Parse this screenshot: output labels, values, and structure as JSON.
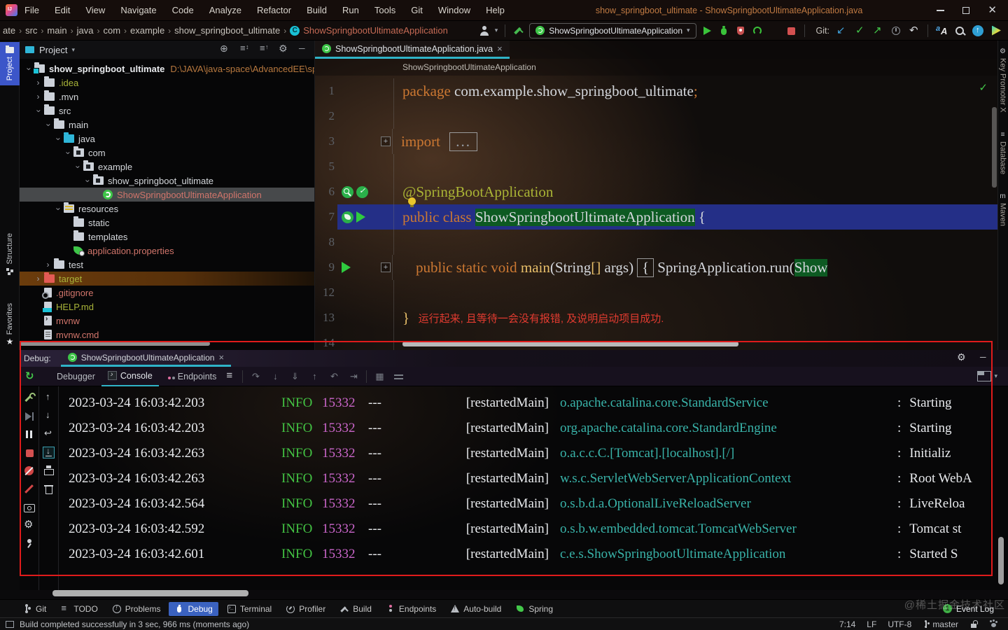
{
  "colors": {
    "accent_cyan": "#2fb3c7",
    "selected_blue": "#3b62c0",
    "stripe_blue": "#3c56c9",
    "info_green": "#43c343",
    "pid_magenta": "#cb66cb",
    "logger_teal": "#39b3a9",
    "keyword_orange": "#cc7832",
    "annotation_olive": "#aab435",
    "error_red": "#e23b30",
    "annotation_rect_red": "#e01b1b",
    "run_green": "#3ac33a",
    "stop_red": "#d35050"
  },
  "window": {
    "title": "show_springboot_ultimate - ShowSpringbootUltimateApplication.java",
    "menus": [
      "File",
      "Edit",
      "View",
      "Navigate",
      "Code",
      "Analyze",
      "Refactor",
      "Build",
      "Run",
      "Tools",
      "Git",
      "Window",
      "Help"
    ]
  },
  "navbar": {
    "crumbs": [
      "ate",
      "src",
      "main",
      "java",
      "com",
      "example",
      "show_springboot_ultimate"
    ],
    "sep": "›",
    "active_crumb": "ShowSpringbootUltimateApplication",
    "run_config": "ShowSpringbootUltimateApplication",
    "caret": "▾",
    "git_label": "Git:",
    "run_icons": [
      "run-play-icon",
      "debug-bug-icon",
      "coverage-icon",
      "profiler-icon",
      "caret-down-icon",
      "stop-icon"
    ],
    "git_icons": [
      "update-icon",
      "commit-check-icon",
      "push-icon",
      "history-icon",
      "rollback-icon"
    ],
    "right_icons": [
      "translate-icon",
      "search-icon",
      "upload-icon",
      "gradient-play-icon"
    ]
  },
  "left_stripe": {
    "top": [
      {
        "label": "Project",
        "icon": "project-folder-icon",
        "cls": "sel"
      }
    ],
    "bottom": [
      {
        "label": "Structure",
        "icon": "structure-icon",
        "cls": ""
      },
      {
        "label": "Favorites",
        "icon": "favorites-star-icon",
        "cls": ""
      }
    ]
  },
  "right_stripe": [
    {
      "label": "Key Promoter X",
      "glyph": "⚙"
    },
    {
      "label": "Database",
      "glyph": "≡"
    },
    {
      "label": "Maven",
      "glyph": "m"
    }
  ],
  "project": {
    "title": "Project",
    "caret": "▾",
    "header_icons": [
      "locate-icon",
      "expand-all-icon",
      "collapse-all-icon",
      "gear-icon",
      "hide-icon"
    ],
    "tree": [
      {
        "depth": 0,
        "chevron": "down",
        "icon": "t-folder t-project",
        "label": "show_springboot_ultimate",
        "extra": "D:\\JAVA\\java-space\\AdvancedEE\\sp",
        "c": "bold",
        "row": ""
      },
      {
        "depth": 1,
        "chevron": "right",
        "icon": "t-folder",
        "label": ".idea",
        "c": "olive",
        "row": ""
      },
      {
        "depth": 1,
        "chevron": "right",
        "icon": "t-folder",
        "label": ".mvn",
        "c": "",
        "row": ""
      },
      {
        "depth": 1,
        "chevron": "down",
        "icon": "t-folder",
        "label": "src",
        "c": "",
        "row": ""
      },
      {
        "depth": 2,
        "chevron": "down",
        "icon": "t-folder",
        "label": "main",
        "c": "",
        "row": ""
      },
      {
        "depth": 3,
        "chevron": "down",
        "icon": "t-folder t-java",
        "label": "java",
        "c": "",
        "row": ""
      },
      {
        "depth": 4,
        "chevron": "down",
        "icon": "t-folder t-pkg",
        "label": "com",
        "c": "",
        "row": ""
      },
      {
        "depth": 5,
        "chevron": "down",
        "icon": "t-folder t-pkg",
        "label": "example",
        "c": "",
        "row": ""
      },
      {
        "depth": 6,
        "chevron": "down",
        "icon": "t-folder t-pkg",
        "label": "show_springboot_ultimate",
        "c": "",
        "row": ""
      },
      {
        "depth": 7,
        "chevron": "",
        "icon": "t-sb",
        "label": "ShowSpringbootUltimateApplication",
        "c": "pink",
        "row": "selected"
      },
      {
        "depth": 3,
        "chevron": "down",
        "icon": "t-folder t-res",
        "label": "resources",
        "c": "",
        "row": ""
      },
      {
        "depth": 4,
        "chevron": "",
        "icon": "t-folder",
        "label": "static",
        "c": "",
        "row": ""
      },
      {
        "depth": 4,
        "chevron": "",
        "icon": "t-folder",
        "label": "templates",
        "c": "",
        "row": ""
      },
      {
        "depth": 4,
        "chevron": "",
        "icon": "t-leaf",
        "label": "application.properties",
        "c": "pink",
        "row": ""
      },
      {
        "depth": 2,
        "chevron": "right",
        "icon": "t-folder",
        "label": "test",
        "c": "",
        "row": ""
      },
      {
        "depth": 1,
        "chevron": "right",
        "icon": "t-folder t-red",
        "label": "target",
        "c": "olive",
        "row": "target-row"
      },
      {
        "depth": 1,
        "chevron": "",
        "icon": "t-doc t-ign",
        "label": ".gitignore",
        "c": "pink",
        "row": ""
      },
      {
        "depth": 1,
        "chevron": "",
        "icon": "t-doc t-md",
        "label": "HELP.md",
        "c": "olive",
        "row": ""
      },
      {
        "depth": 1,
        "chevron": "",
        "icon": "t-doc t-sh",
        "label": "mvnw",
        "c": "pink",
        "row": ""
      },
      {
        "depth": 1,
        "chevron": "",
        "icon": "t-doc t-cmd",
        "label": "mvnw.cmd",
        "c": "pink",
        "row": ""
      }
    ]
  },
  "editor": {
    "tab_label": "ShowSpringbootUltimateApplication.java",
    "tab_close": "×",
    "breadcrumb": "ShowSpringbootUltimateApplication",
    "inspections_ok": "✓",
    "lines": [
      {
        "num": "1",
        "fold": "",
        "cls": "",
        "gut": [],
        "tokens": [
          {
            "t": "package ",
            "c": "kw"
          },
          {
            "t": "com.example.show_springboot_ultimate",
            "c": "pl"
          },
          {
            "t": ";",
            "c": "kw"
          }
        ]
      },
      {
        "num": "2",
        "fold": "",
        "cls": "",
        "gut": [],
        "tokens": []
      },
      {
        "num": "3",
        "fold": "+",
        "cls": "",
        "gut": [],
        "tokens": [
          {
            "t": "import ",
            "c": "kw"
          },
          {
            "t": "...",
            "c": "foldbox"
          }
        ]
      },
      {
        "num": "5",
        "fold": "",
        "cls": "",
        "gut": [],
        "tokens": []
      },
      {
        "num": "6",
        "fold": "",
        "cls": "",
        "gut": [
          "gutter-spring-search-icon",
          "gutter-spring-check-icon"
        ],
        "tokens": [
          {
            "t": "@SpringBootApplication",
            "c": "ann"
          }
        ]
      },
      {
        "num": "7",
        "fold": "",
        "cls": "exec",
        "gut": [
          "gutter-spring-leaf-icon",
          "gutter-run-icon"
        ],
        "tokens": [
          {
            "t": "public class ",
            "c": "kw"
          },
          {
            "t": "ShowSpringbootUltimateApplication",
            "c": "pl hlg"
          },
          {
            "t": " {",
            "c": "pl"
          }
        ]
      },
      {
        "num": "8",
        "fold": "",
        "cls": "",
        "gut": [],
        "tokens": []
      },
      {
        "num": "9",
        "fold": "+",
        "cls": "",
        "gut": [
          "gutter-run-icon"
        ],
        "tokens": [
          {
            "t": "    public static void ",
            "c": "kw"
          },
          {
            "t": "main",
            "c": "fn"
          },
          {
            "t": "(String",
            "c": "pl"
          },
          {
            "t": "[]",
            "c": "fn"
          },
          {
            "t": " args)",
            "c": "pl"
          },
          {
            "t": "{",
            "c": "brbox"
          },
          {
            "t": "SpringApplication.run",
            "c": "pl"
          },
          {
            "t": "(",
            "c": "pl"
          },
          {
            "t": "Show",
            "c": "pl hlg"
          }
        ]
      },
      {
        "num": "12",
        "fold": "",
        "cls": "",
        "gut": [],
        "tokens": []
      },
      {
        "num": "13",
        "fold": "",
        "cls": "",
        "gut": [],
        "tokens": [
          {
            "t": "}",
            "c": "fn"
          },
          {
            "t": "   运行起来, 且等待一会没有报错, 及说明启动项目成功.",
            "c": "cmt"
          }
        ]
      },
      {
        "num": "14",
        "fold": "",
        "cls": "",
        "gut": [],
        "tokens": []
      }
    ]
  },
  "debug": {
    "label": "Debug:",
    "tab_label": "ShowSpringbootUltimateApplication",
    "tab_close": "×",
    "header_icons": [
      "gear-icon",
      "minimize-icon"
    ],
    "tabs": [
      {
        "label": "Debugger",
        "icon": "",
        "cls": ""
      },
      {
        "label": "Console",
        "icon": "console-icon",
        "cls": "sel"
      },
      {
        "label": "Endpoints",
        "icon": "endpoints-icon",
        "cls": ""
      }
    ],
    "step_icons": [
      "step-over-icon",
      "step-into-icon",
      "force-step-into-icon",
      "step-out-icon",
      "drop-frame-icon",
      "run-to-cursor-icon"
    ],
    "eval_icons": [
      "evaluate-icon",
      "layout-settings-icon"
    ],
    "left_icons": [
      "wrench-icon",
      "resume-icon",
      "pause-icon",
      "stop-icon-red",
      "mute-breakpoints-icon",
      "breakpoint-slash-icon",
      "camera-icon",
      "settings-gear-icon",
      "pin-icon"
    ],
    "console_icons": [
      {
        "icon": "up-arrow-icon",
        "cls": ""
      },
      {
        "icon": "down-arrow-icon",
        "cls": ""
      },
      {
        "icon": "soft-wrap-icon",
        "cls": ""
      },
      {
        "icon": "scroll-end-icon",
        "cls": "sel"
      },
      {
        "icon": "print-icon",
        "cls": ""
      },
      {
        "icon": "clear-icon",
        "cls": ""
      }
    ],
    "console": {
      "dashes": "---",
      "lbr": "[",
      "rbr": "]",
      "colon": ":",
      "rows": [
        {
          "time": "2023-03-24 16:03:42.203",
          "level": "INFO",
          "pid": "15332",
          "thread": "restartedMain",
          "logger": "o.apache.catalina.core.StandardService",
          "msg": "Starting"
        },
        {
          "time": "2023-03-24 16:03:42.203",
          "level": "INFO",
          "pid": "15332",
          "thread": "restartedMain",
          "logger": "org.apache.catalina.core.StandardEngine",
          "msg": "Starting"
        },
        {
          "time": "2023-03-24 16:03:42.263",
          "level": "INFO",
          "pid": "15332",
          "thread": "restartedMain",
          "logger": "o.a.c.c.C.[Tomcat].[localhost].[/]",
          "msg": "Initializ"
        },
        {
          "time": "2023-03-24 16:03:42.263",
          "level": "INFO",
          "pid": "15332",
          "thread": "restartedMain",
          "logger": "w.s.c.ServletWebServerApplicationContext",
          "msg": "Root WebA"
        },
        {
          "time": "2023-03-24 16:03:42.564",
          "level": "INFO",
          "pid": "15332",
          "thread": "restartedMain",
          "logger": "o.s.b.d.a.OptionalLiveReloadServer",
          "msg": "LiveReloa"
        },
        {
          "time": "2023-03-24 16:03:42.592",
          "level": "INFO",
          "pid": "15332",
          "thread": "restartedMain",
          "logger": "o.s.b.w.embedded.tomcat.TomcatWebServer",
          "msg": "Tomcat st"
        },
        {
          "time": "2023-03-24 16:03:42.601",
          "level": "INFO",
          "pid": "15332",
          "thread": "restartedMain",
          "logger": "c.e.s.ShowSpringbootUltimateApplication",
          "msg": "Started S"
        }
      ]
    }
  },
  "bottom_bar": {
    "items": [
      {
        "label": "Git",
        "icon": "git-branch-icon",
        "cls": ""
      },
      {
        "label": "TODO",
        "icon": "todo-icon",
        "cls": ""
      },
      {
        "label": "Problems",
        "icon": "problems-icon",
        "cls": ""
      },
      {
        "label": "Debug",
        "icon": "debug-chip-icon",
        "cls": "sel"
      },
      {
        "label": "Terminal",
        "icon": "terminal-icon",
        "cls": ""
      },
      {
        "label": "Profiler",
        "icon": "profiler-small-icon",
        "cls": ""
      },
      {
        "label": "Build",
        "icon": "build-small-icon",
        "cls": ""
      },
      {
        "label": "Endpoints",
        "icon": "endpoints-small-icon",
        "cls": ""
      },
      {
        "label": "Auto-build",
        "icon": "autobuild-icon",
        "cls": ""
      },
      {
        "label": "Spring",
        "icon": "spring-leaf-icon",
        "cls": ""
      }
    ],
    "event_log": "Event Log",
    "event_count": "1",
    "watermark": "@稀土掘金技术社区"
  },
  "status_bar": {
    "message": "Build completed successfully in 3 sec, 966 ms (moments ago)",
    "position": "7:14",
    "line_ending": "LF",
    "encoding": "UTF-8",
    "branch": "master"
  }
}
